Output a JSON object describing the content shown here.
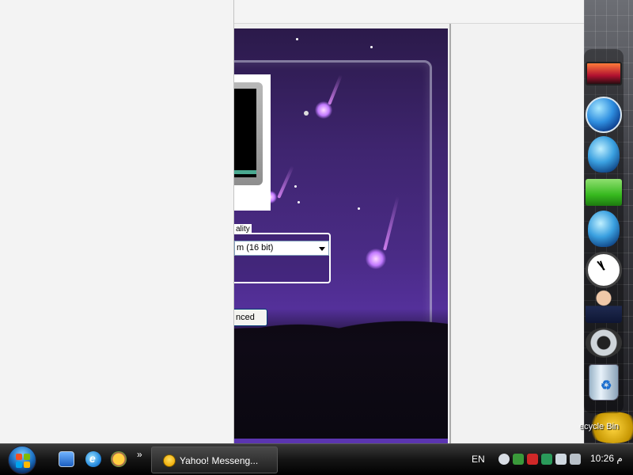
{
  "display_panel": {
    "group_title_fragment": "ality",
    "color_quality_value": "m (16 bit)",
    "advanced_button_fragment": "nced"
  },
  "desktop": {
    "recycle_bin_label": "ecycle Bin"
  },
  "taskbar": {
    "task_button_label": "Yahoo! Messeng...",
    "language": "EN",
    "clock_time": "10:26 م"
  },
  "icons": {
    "start": "windows-start-orb",
    "quick_launch": [
      "show-desktop-icon",
      "internet-explorer-icon",
      "messenger-icon"
    ],
    "dock": [
      "wallpaper-thumbnail-icon",
      "globe-icon",
      "globe-icon",
      "green-folder-icon",
      "globe-icon",
      "analog-clock-icon",
      "user-icon",
      "gear-icon",
      "recycle-bin-icon"
    ]
  },
  "colors": {
    "wallpaper_purple": "#4a2b86",
    "taskbar": "#141414",
    "accent_blue": "#003c74"
  }
}
